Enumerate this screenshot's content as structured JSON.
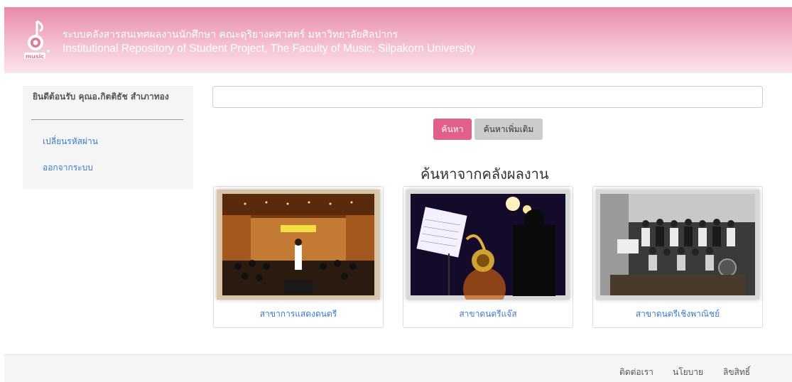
{
  "header": {
    "title_th": "ระบบคลังสารสนเทศผลงานนักศึกษา คณะดุริยางคศาสตร์ มหาวิทยาลัยศิลปากร",
    "title_en": "Institutional Repository of Student Project, The Faculty of Music, Silpakorn University",
    "logo_text": "music"
  },
  "sidebar": {
    "welcome": "ยินดีต้อนรับ คุณอ.กิตติธัช สำเภาทอง",
    "links": [
      {
        "label": "เปลี่ยนรหัสผ่าน"
      },
      {
        "label": "ออกจากระบบ"
      }
    ]
  },
  "search": {
    "placeholder": "",
    "search_button": "ค้นหา",
    "advanced_button": "ค้นหาเพิ่มเติม"
  },
  "section_title": "ค้นหาจากคลังผลงาน",
  "cards": [
    {
      "label": "สาขาการแสดงดนตรี"
    },
    {
      "label": "สาขาดนตรีแจ๊ส"
    },
    {
      "label": "สาขาดนตรีเชิงพาณิชย์"
    }
  ],
  "footer": {
    "links": [
      {
        "label": "ติดต่อเรา"
      },
      {
        "label": "นโยบาย"
      },
      {
        "label": "ลิขสิทธิ์"
      }
    ]
  },
  "colors": {
    "header_pink": "#e88aa7",
    "accent": "#e0608a",
    "link_blue": "#3a7bc8"
  }
}
